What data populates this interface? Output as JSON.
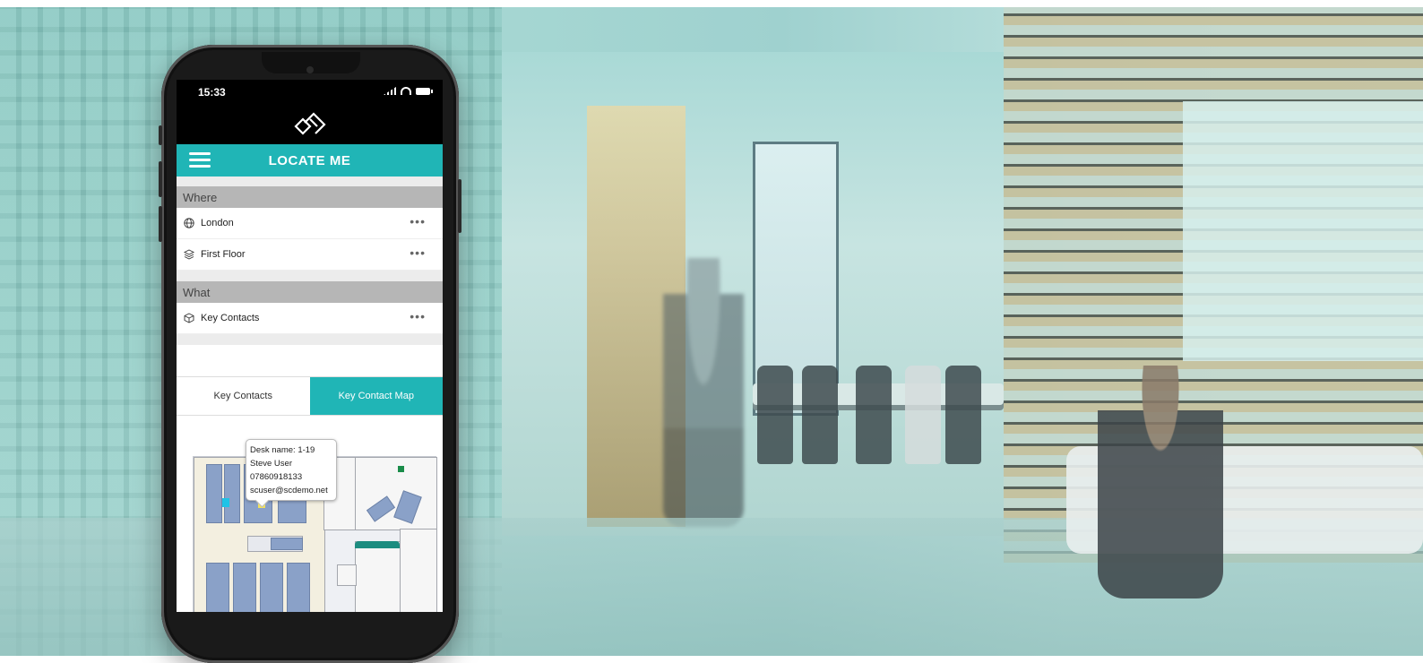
{
  "status": {
    "time": "15:33"
  },
  "header": {
    "title": "LOCATE ME"
  },
  "where": {
    "label": "Where",
    "items": [
      {
        "label": "London",
        "icon": "globe-icon"
      },
      {
        "label": "First Floor",
        "icon": "layers-icon"
      }
    ]
  },
  "what": {
    "label": "What",
    "items": [
      {
        "label": "Key Contacts",
        "icon": "box-icon"
      }
    ]
  },
  "tabs": [
    {
      "label": "Key Contacts",
      "active": false
    },
    {
      "label": "Key Contact Map",
      "active": true
    }
  ],
  "tooltip": {
    "desk": "Desk name: 1-19",
    "name": "Steve User",
    "phone": "07860918133",
    "email": "scuser@scdemo.net"
  },
  "colors": {
    "accent": "#20b5b6",
    "section": "#b6b6b6"
  }
}
